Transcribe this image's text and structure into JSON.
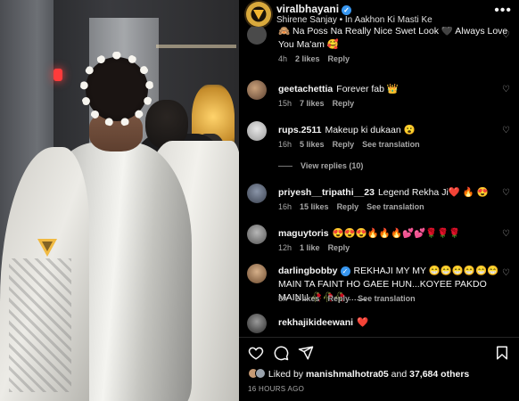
{
  "post": {
    "username": "viralbhayani",
    "song": "Shirene Sanjay • In Aakhon Ki Masti Ke",
    "more_label": "•••"
  },
  "comments": [
    {
      "text": "🙈 Na Poss Na Really Nice Swet Look 🖤 Always Love You Ma'am 🥰",
      "time": "4h",
      "likes": "2 likes",
      "reply": "Reply"
    },
    {
      "user": "geetachettia",
      "text": "Forever fab 👑",
      "time": "15h",
      "likes": "7 likes",
      "reply": "Reply"
    },
    {
      "user": "rups.2511",
      "text": "Makeup ki dukaan 😮",
      "time": "16h",
      "likes": "5 likes",
      "reply": "Reply",
      "translation": "See translation",
      "view_replies": "View replies (10)"
    },
    {
      "user": "priyesh__tripathi__23",
      "text": "Legend Rekha Ji❤️ 🔥 😍",
      "time": "16h",
      "likes": "15 likes",
      "reply": "Reply",
      "translation": "See translation"
    },
    {
      "user": "maguytoris",
      "text": "😍😍😍🔥🔥🔥💕💕🌹🌹🌹",
      "time": "12h",
      "likes": "1 like",
      "reply": "Reply"
    },
    {
      "user": "darlingbobby",
      "text": "REKHAJI MY MY 😁😁😁😁😁😁MAIN TA FAINT HO GAEE HUN...KOYEE PAKDO MAINU 🥀🥀🥀 .......",
      "time": "8h",
      "likes": "2 likes",
      "reply": "Reply",
      "translation": "See translation"
    },
    {
      "user": "rekhajikideewani",
      "text": "❤️"
    }
  ],
  "footer": {
    "liked_by_prefix": "Liked by",
    "liked_by_user": "manishmalhotra05",
    "and": "and",
    "others": "37,684 others",
    "time_ago": "16 HOURS AGO"
  },
  "icons": [
    "heart-icon",
    "comment-icon",
    "share-icon",
    "bookmark-icon",
    "verified-icon"
  ],
  "colors": {
    "verified": "#3897f0",
    "meta": "#a8a8a8",
    "avatar_brand": "#d9a93c"
  }
}
